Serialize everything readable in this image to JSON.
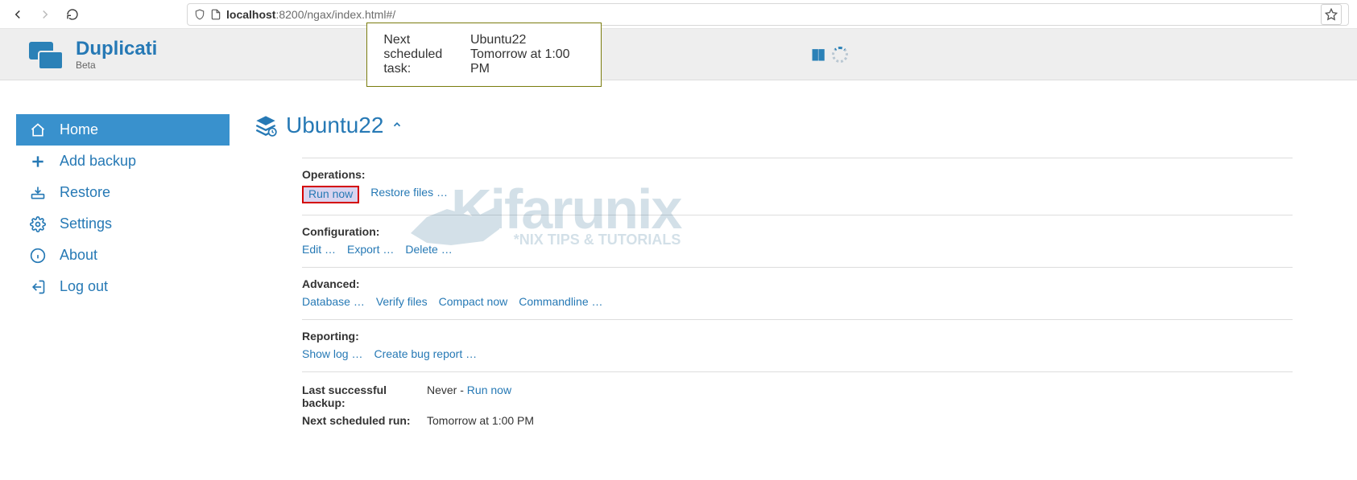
{
  "browser": {
    "host": "localhost",
    "port_path": ":8200/ngax/index.html#/"
  },
  "brand": {
    "title": "Duplicati",
    "sub": "Beta"
  },
  "schedule_bar": {
    "label": "Next scheduled task:",
    "value": "Ubuntu22 Tomorrow at 1:00 PM"
  },
  "sidebar": {
    "items": [
      {
        "label": "Home"
      },
      {
        "label": "Add backup"
      },
      {
        "label": "Restore"
      },
      {
        "label": "Settings"
      },
      {
        "label": "About"
      },
      {
        "label": "Log out"
      }
    ]
  },
  "job": {
    "name": "Ubuntu22"
  },
  "sections": {
    "operations": {
      "title": "Operations:",
      "run_now": "Run now",
      "restore_files": "Restore files …"
    },
    "configuration": {
      "title": "Configuration:",
      "edit": "Edit …",
      "export": "Export …",
      "delete": "Delete …"
    },
    "advanced": {
      "title": "Advanced:",
      "database": "Database …",
      "verify": "Verify files",
      "compact": "Compact now",
      "cli": "Commandline …"
    },
    "reporting": {
      "title": "Reporting:",
      "showlog": "Show log …",
      "createbug": "Create bug report …"
    }
  },
  "meta": {
    "last_label": "Last successful backup:",
    "last_value": "Never - ",
    "last_run_now": "Run now",
    "next_label": "Next scheduled run:",
    "next_value": "Tomorrow at 1:00 PM"
  },
  "watermark": {
    "big": "Kifarunix",
    "sub": "*NIX TIPS & TUTORIALS"
  }
}
